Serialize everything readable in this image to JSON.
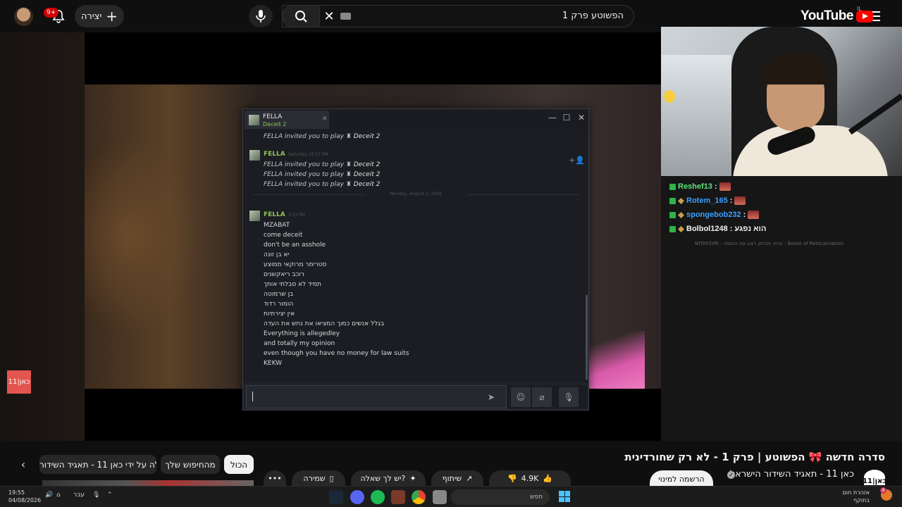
{
  "topbar": {
    "logo_text": "YouTube",
    "country_code": "IL",
    "search_value": "הפשוטע פרק 1",
    "create_label": "יצירה",
    "notification_count": "9+"
  },
  "kan_badge": "כאן|11",
  "twitch_chat": [
    {
      "user": "Reshef13",
      "sep": ":",
      "color": "#5ee07a",
      "text": "",
      "emote": true
    },
    {
      "user": "Rotem_165",
      "sep": ":",
      "color": "#3aa0ff",
      "text": "",
      "emote": true
    },
    {
      "user": "spongebob232",
      "sep": ":",
      "color": "#3aa0ff",
      "text": "",
      "emote": true
    },
    {
      "user": "Bolbol1248",
      "sep": ":",
      "color": "#f1f1f1",
      "text": "הוא נפגע",
      "emote": false
    }
  ],
  "twitch_faded": "NITAYSVR : ערוץ תבדוק רצע את החומה : Beast of Reincarnation",
  "steam": {
    "tab_name": "FELLA",
    "tab_game": "Deceit 2",
    "invite_prefix": "FELLA invited you to play",
    "game": "Deceit 2",
    "sender": "FELLA",
    "time1": "Saturday 10:57 PM",
    "date_divider": "Monday, August 3, 2026",
    "time2": "7:53 PM",
    "messages": [
      "MZABAT",
      "come deceit",
      "don't be an asshole",
      "יא בן זונה",
      "סטרימר מרוקאי ממוצע",
      "רוכב ריאקשנים",
      "תמיד לא סבלתי אותך",
      "בן שרמוטה",
      "הומור רדוד",
      "אין יצירתיות",
      "בגלל אנשים כמוך המציאו את נחש את העדה",
      "Everything is allegedley",
      "and totally my opinion",
      "even though you have no money for law suits",
      "KEKW"
    ]
  },
  "video": {
    "title": "סדרה חדשה 🎀 הפשוטע | פרק 1 - לא רק שחורדינית",
    "channel": "כאן 11 - תאגיד השידור הישראלי",
    "channel_logo": "כאן|11",
    "subscribe_label": "הרשמה למינוי",
    "likes": "4.9K",
    "share_label": "שיתוף",
    "ask_label": "יש לך שאלה?",
    "save_label": "שמירה"
  },
  "chips": {
    "all": "הכול",
    "from_search": "מהחיפוש שלך",
    "uploaded_by": "הועלה על ידי כאן 11 - תאגיד השידור"
  },
  "taskbar": {
    "time": "19:55",
    "date": "04/08/2026",
    "lang": "עבר",
    "search_placeholder": "חפש",
    "weather_line1": "אזהרת חום",
    "weather_line2": "בתוקף",
    "weather_badge": "8"
  },
  "colors": {
    "accent_red": "#ff0000",
    "steam_green": "#91c257",
    "windows_blue": "#4cc2ff"
  }
}
